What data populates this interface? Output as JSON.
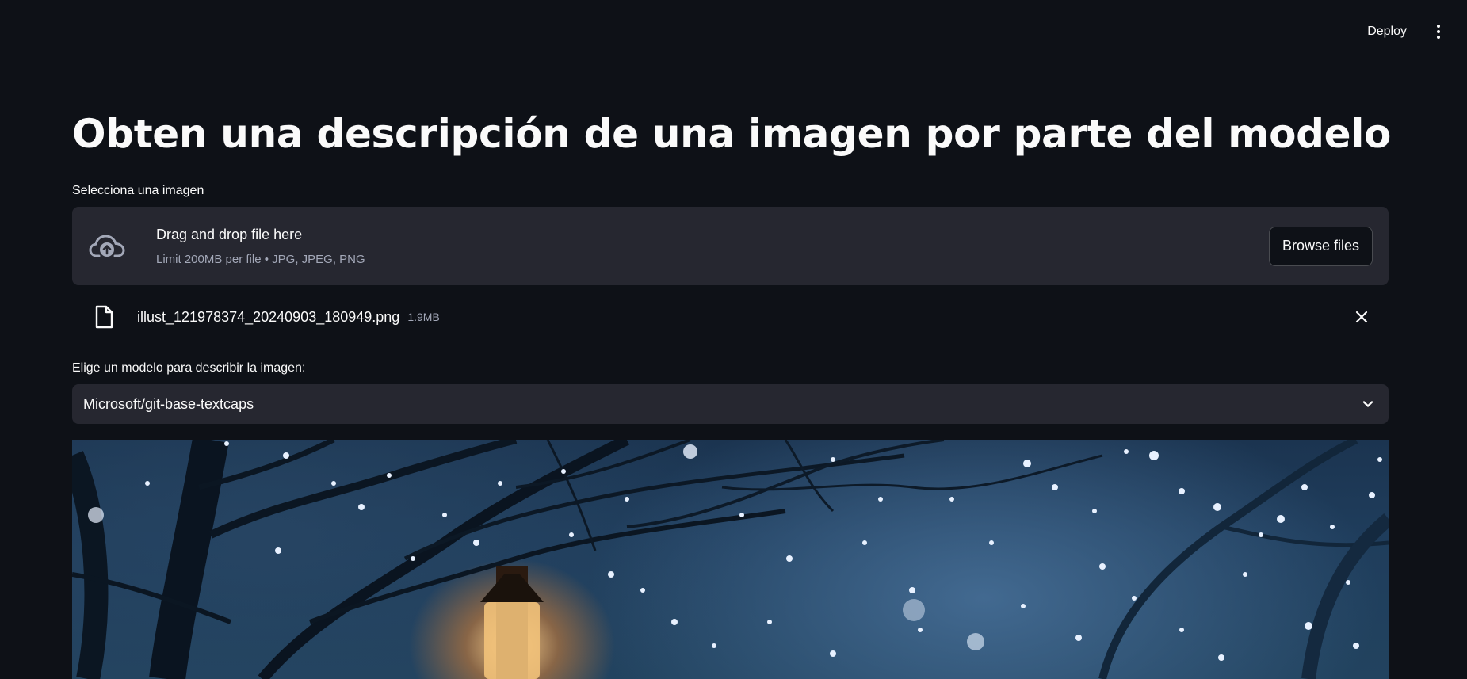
{
  "header": {
    "deploy_label": "Deploy"
  },
  "page": {
    "title": "Obten una descripción de una imagen por parte del modelo"
  },
  "uploader": {
    "label": "Selecciona una imagen",
    "drop_title": "Drag and drop file here",
    "drop_subtitle": "Limit 200MB per file • JPG, JPEG, PNG",
    "browse_label": "Browse files",
    "icon": "cloud-upload-icon"
  },
  "uploaded_file": {
    "name": "illust_121978374_20240903_180949.png",
    "size": "1.9MB",
    "icon": "file-icon"
  },
  "model_select": {
    "label": "Elige un modelo para describir la imagen:",
    "selected": "Microsoft/git-base-textcaps"
  },
  "colors": {
    "background": "#0e1117",
    "surface": "#262730",
    "text": "#fafafa",
    "muted_text": "#a3a8b8"
  }
}
